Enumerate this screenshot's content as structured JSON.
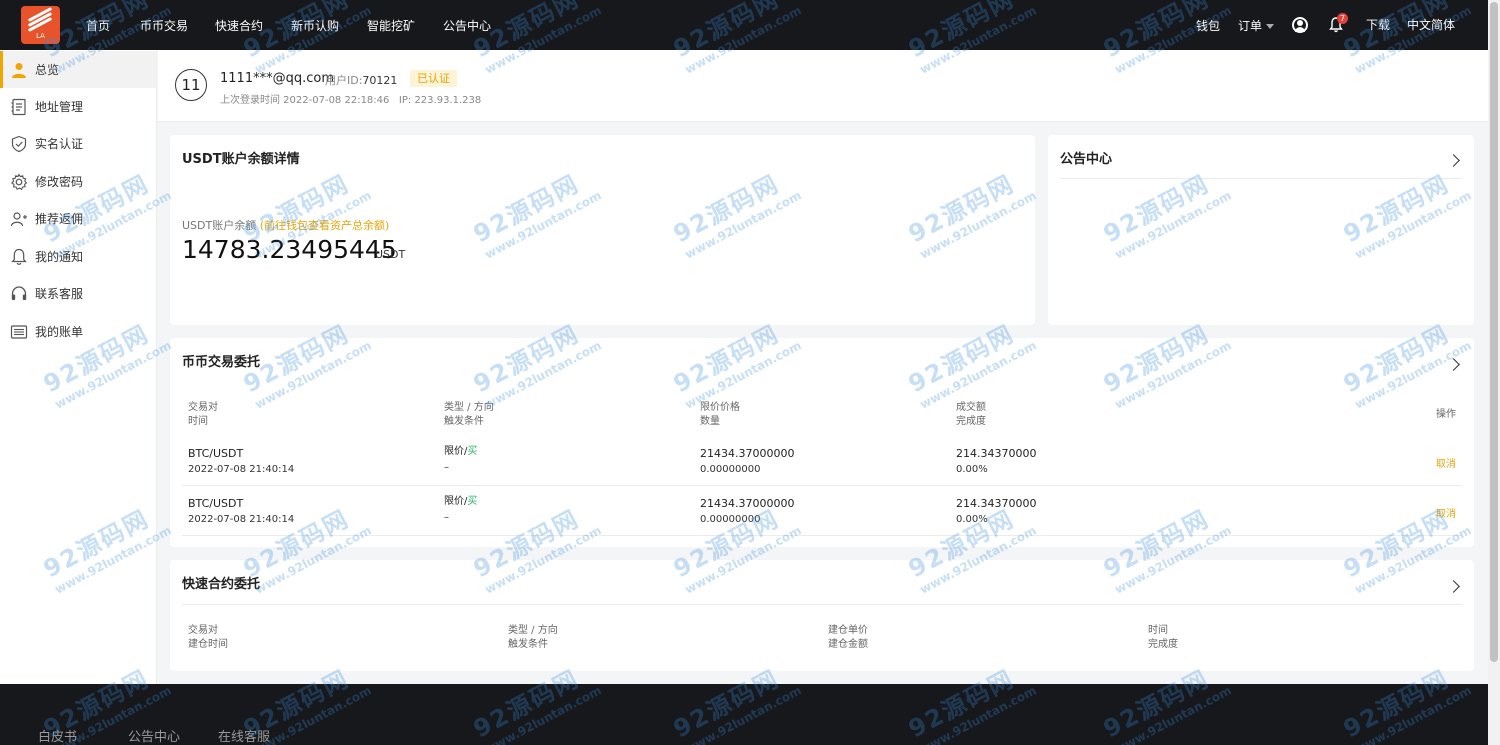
{
  "nav": {
    "items": [
      "首页",
      "币币交易",
      "快速合约",
      "新币认购",
      "智能挖矿",
      "公告中心"
    ],
    "wallet": "钱包",
    "orders": "订单",
    "notif_count": "7",
    "download": "下载",
    "language": "中文简体",
    "logo_text": "LA"
  },
  "sidebar": {
    "items": [
      {
        "label": "总览",
        "icon": "user-icon"
      },
      {
        "label": "地址管理",
        "icon": "address-book-icon"
      },
      {
        "label": "实名认证",
        "icon": "shield-check-icon"
      },
      {
        "label": "修改密码",
        "icon": "gear-icon"
      },
      {
        "label": "推荐返佣",
        "icon": "add-user-icon"
      },
      {
        "label": "我的通知",
        "icon": "bell-icon"
      },
      {
        "label": "联系客服",
        "icon": "headset-icon"
      },
      {
        "label": "我的账单",
        "icon": "list-icon"
      }
    ]
  },
  "profile": {
    "avatar": "11",
    "email": "1111***@qq.com",
    "uid_label": "用户ID:",
    "uid": "70121",
    "verified": "已认证",
    "last_login": "上次登录时间 2022-07-08 22:18:46   IP: 223.93.1.238"
  },
  "balance": {
    "title": "USDT账户余额详情",
    "label": "USDT账户余额",
    "hint": "(前往钱包查看资产总余额)",
    "value": "14783.23495445",
    "unit": "USDT"
  },
  "announce": {
    "title": "公告中心"
  },
  "spot": {
    "title": "币币交易委托",
    "headers": {
      "c1a": "交易对",
      "c1b": "时间",
      "c2a": "类型 / 方向",
      "c2b": "触发条件",
      "c3a": "限价价格",
      "c3b": "数量",
      "c4a": "成交额",
      "c4b": "完成度",
      "c5": "操作"
    },
    "rows": [
      {
        "pair": "BTC/USDT",
        "time": "2022-07-08 21:40:14",
        "type": "限价",
        "dir": "买",
        "trigger": "–",
        "price": "21434.37000000",
        "qty": "0.00000000",
        "amount": "214.34370000",
        "progress": "0.00%",
        "action": "取消"
      },
      {
        "pair": "BTC/USDT",
        "time": "2022-07-08 21:40:14",
        "type": "限价",
        "dir": "买",
        "trigger": "–",
        "price": "21434.37000000",
        "qty": "0.00000000",
        "amount": "214.34370000",
        "progress": "0.00%",
        "action": "取消"
      }
    ]
  },
  "futures": {
    "title": "快速合约委托",
    "headers": {
      "c1a": "交易对",
      "c1b": "建仓时间",
      "c2a": "类型 / 方向",
      "c2b": "触发条件",
      "c3a": "建仓单价",
      "c3b": "建仓金额",
      "c4a": "时间",
      "c4b": "完成度"
    }
  },
  "footer": {
    "links": [
      "白皮书",
      "公告中心",
      "在线客服"
    ]
  },
  "watermark": {
    "big": "92源码网",
    "small": "www.92luntan.com"
  }
}
